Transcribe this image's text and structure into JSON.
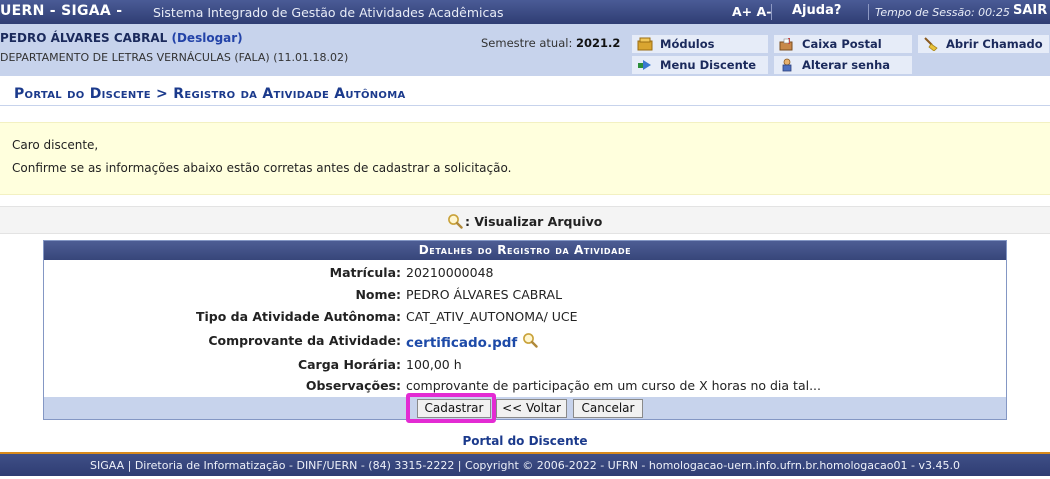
{
  "header": {
    "brand": "UERN - SIGAA -",
    "system_name": "Sistema Integrado de Gestão de Atividades Acadêmicas",
    "font_increase": "A+",
    "font_decrease": "A-",
    "help": "Ajuda?",
    "session_label": "Tempo de Sessão: 00:25",
    "exit": "SAIR"
  },
  "user": {
    "name": "PEDRO ÁLVARES CABRAL",
    "logout": "(Deslogar)",
    "department": "DEPARTAMENTO DE LETRAS VERNÁCULAS (FALA) (11.01.18.02)",
    "semester_label": "Semestre atual:",
    "semester_value": "2021.2"
  },
  "quick_links": {
    "modules": "Módulos",
    "mailbox": "Caixa Postal",
    "open_ticket": "Abrir Chamado",
    "student_menu": "Menu Discente",
    "change_password": "Alterar senha"
  },
  "breadcrumb": "Portal do Discente > Registro da Atividade Autônoma",
  "message": {
    "greeting": "Caro discente,",
    "body": "Confirme se as informações abaixo estão corretas antes de cadastrar a solicitação."
  },
  "legend": {
    "view_file": ": Visualizar Arquivo"
  },
  "details": {
    "caption": "Detalhes do Registro da Atividade",
    "rows": [
      {
        "label": "Matrícula:",
        "value": "20210000048"
      },
      {
        "label": "Nome:",
        "value": "PEDRO ÁLVARES CABRAL"
      },
      {
        "label": "Tipo da Atividade Autônoma:",
        "value": "CAT_ATIV_AUTONOMA/ UCE"
      },
      {
        "label": "Comprovante da Atividade:",
        "value": "certificado.pdf"
      },
      {
        "label": "Carga Horária:",
        "value": "100,00 h"
      },
      {
        "label": "Observações:",
        "value": "comprovante de participação em um curso de X horas no dia tal..."
      }
    ]
  },
  "actions": {
    "submit": "Cadastrar",
    "back": "<< Voltar",
    "cancel": "Cancelar"
  },
  "footer": {
    "portal_link": "Portal do Discente",
    "text": "SIGAA | Diretoria de Informatização - DINF/UERN - (84) 3315-2222 | Copyright © 2006-2022 - UFRN - homologacao-uern.info.ufrn.br.homologacao01 - v3.45.0"
  },
  "colors": {
    "header_bg": "#3b4a80",
    "info_bg": "#c7d3ec",
    "message_bg": "#ffffdd",
    "highlight": "#e32bd3"
  }
}
